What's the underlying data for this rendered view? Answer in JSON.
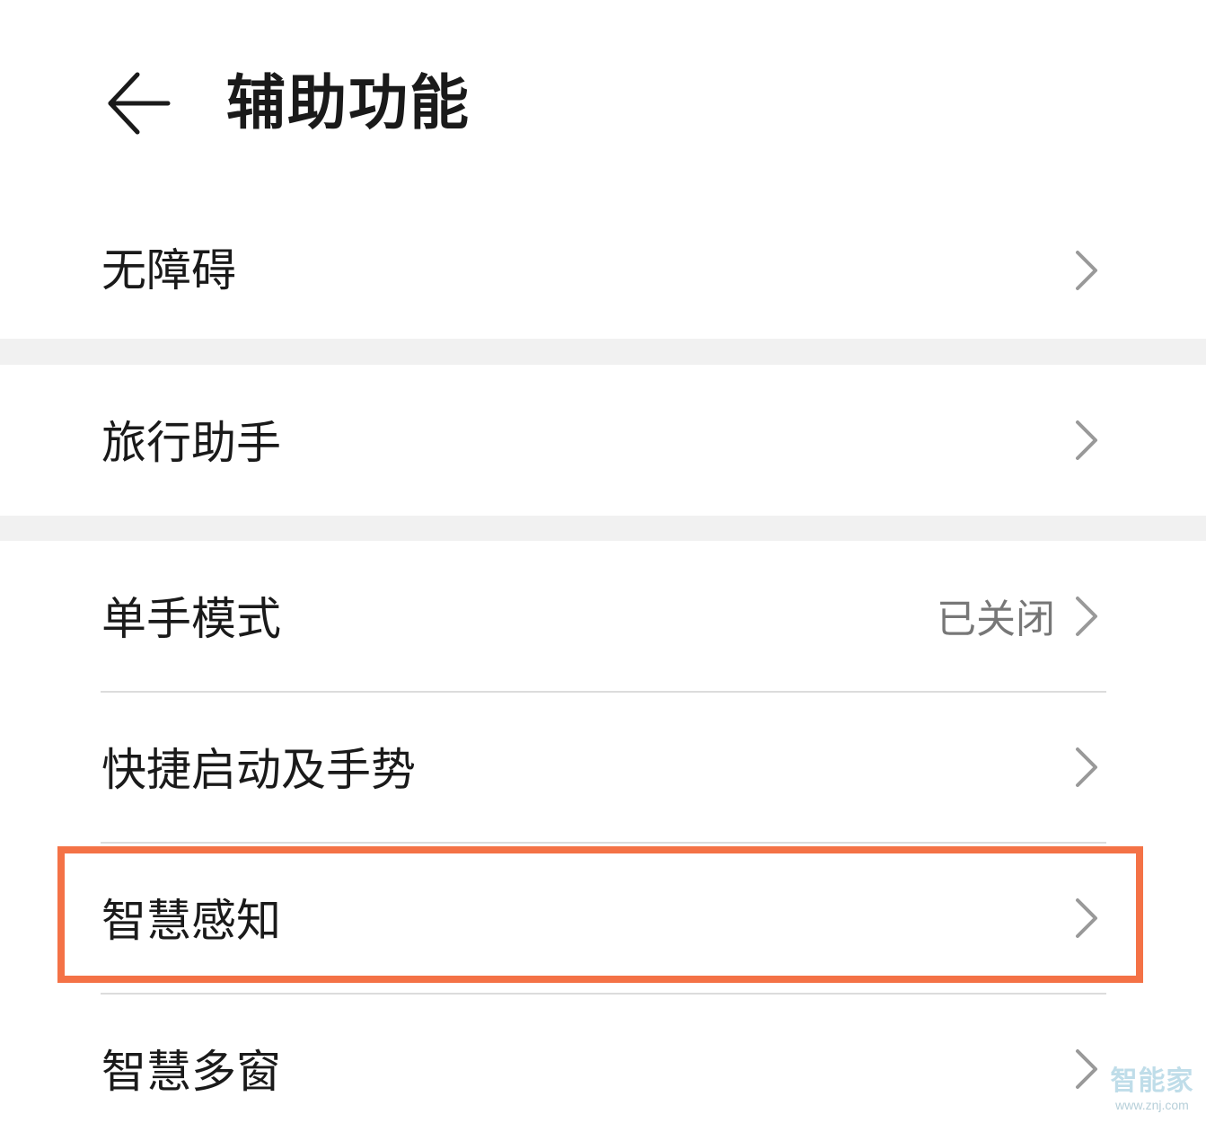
{
  "header": {
    "back_icon": "arrow-left-icon",
    "title": "辅助功能"
  },
  "items": [
    {
      "label": "无障碍",
      "value": "",
      "icon": "chevron-right-icon"
    },
    {
      "label": "旅行助手",
      "value": "",
      "icon": "chevron-right-icon"
    },
    {
      "label": "单手模式",
      "value": "已关闭",
      "icon": "chevron-right-icon"
    },
    {
      "label": "快捷启动及手势",
      "value": "",
      "icon": "chevron-right-icon"
    },
    {
      "label": "智慧感知",
      "value": "",
      "icon": "chevron-right-icon",
      "highlighted": true
    },
    {
      "label": "智慧多窗",
      "value": "",
      "icon": "chevron-right-icon"
    }
  ],
  "highlight_color": "#f47246",
  "watermark": {
    "text": "智能家",
    "url_text": "www.znj.com"
  }
}
